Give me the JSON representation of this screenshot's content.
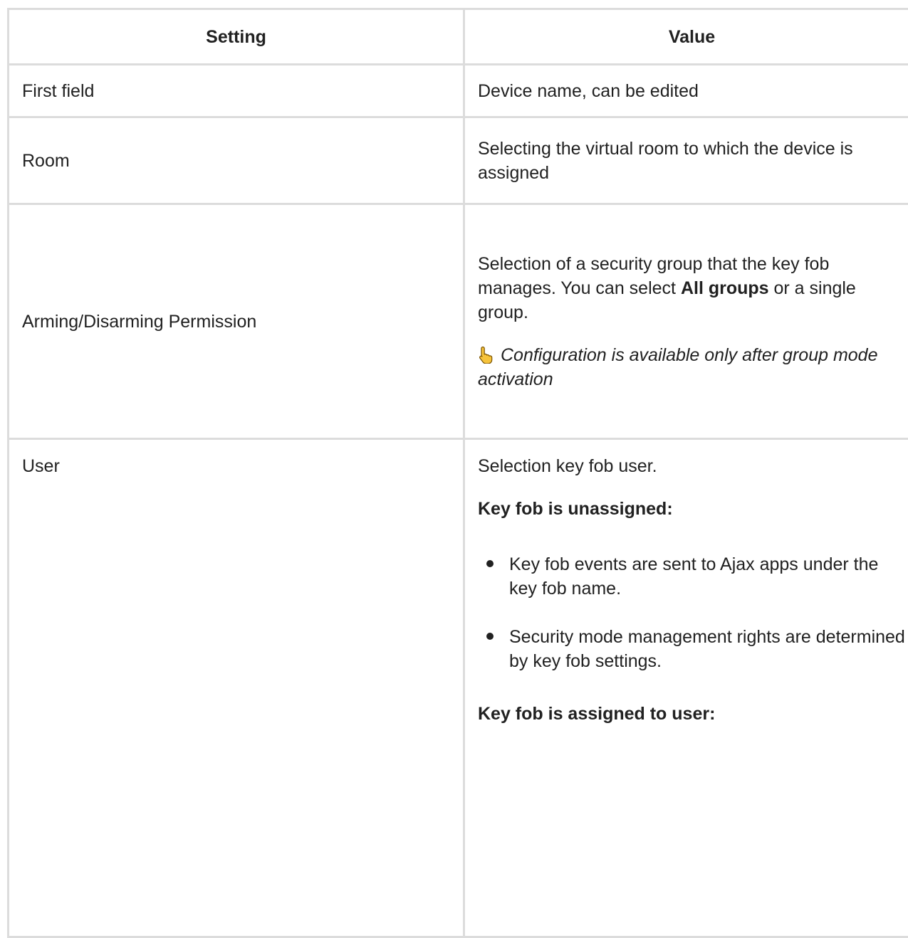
{
  "table": {
    "headers": {
      "setting": "Setting",
      "value": "Value"
    },
    "rows": {
      "first_field": {
        "setting": "First field",
        "value": "Device name, can be edited"
      },
      "room": {
        "setting": "Room",
        "value": "Selecting the virtual room to which the device is assigned"
      },
      "arming": {
        "setting": "Arming/Disarming Permission",
        "value_pre": "Selection of a security group that the key fob manages. You can select ",
        "value_bold": "All groups",
        "value_post": " or a single group.",
        "note_icon": "pointing-hand-icon",
        "note": "Configuration is available only after group mode activation"
      },
      "user": {
        "setting": "User",
        "intro": "Selection key fob user.",
        "unassigned_heading": "Key fob is unassigned:",
        "unassigned_items": [
          "Key fob events are sent to Ajax apps under the key fob name.",
          "Security mode management rights are determined by key fob settings."
        ],
        "assigned_heading": "Key fob is assigned to user:"
      }
    }
  }
}
